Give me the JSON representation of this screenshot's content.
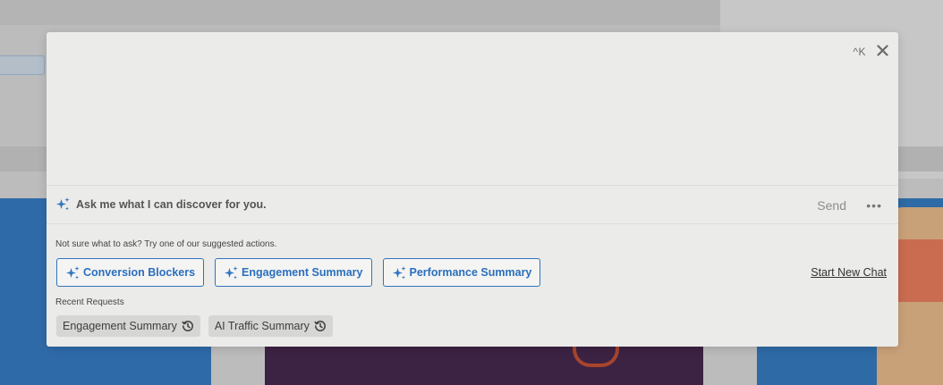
{
  "modal": {
    "shortcut": "^K",
    "prompt": "Ask me what I can discover for you.",
    "send_label": "Send",
    "more_label": "•••",
    "suggest_label": "Not sure what to ask? Try one of our suggested actions.",
    "suggestions": [
      {
        "label": "Conversion Blockers"
      },
      {
        "label": "Engagement Summary"
      },
      {
        "label": "Performance Summary"
      }
    ],
    "start_new_chat": "Start New Chat",
    "recent_label": "Recent Requests",
    "recent": [
      {
        "label": "Engagement Summary"
      },
      {
        "label": "AI Traffic Summary"
      }
    ]
  },
  "icons": {
    "sparkle": "sparkle-icon",
    "close": "close-icon",
    "history": "history-icon"
  },
  "colors": {
    "accent": "#2f74c0",
    "modal_bg": "#ebebe9",
    "chip_bg": "#d6d6d4"
  }
}
